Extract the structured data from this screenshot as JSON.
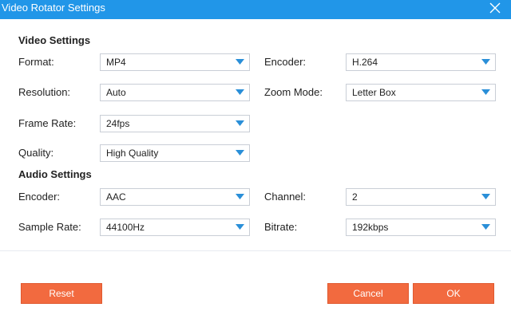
{
  "window": {
    "title": "Video Rotator Settings"
  },
  "video_settings": {
    "heading": "Video Settings",
    "format": {
      "label": "Format:",
      "value": "MP4"
    },
    "encoder": {
      "label": "Encoder:",
      "value": "H.264"
    },
    "resolution": {
      "label": "Resolution:",
      "value": "Auto"
    },
    "zoom_mode": {
      "label": "Zoom Mode:",
      "value": "Letter Box"
    },
    "frame_rate": {
      "label": "Frame Rate:",
      "value": "24fps"
    },
    "quality": {
      "label": "Quality:",
      "value": "High Quality"
    }
  },
  "audio_settings": {
    "heading": "Audio Settings",
    "encoder": {
      "label": "Encoder:",
      "value": "AAC"
    },
    "channel": {
      "label": "Channel:",
      "value": "2"
    },
    "sample_rate": {
      "label": "Sample Rate:",
      "value": "44100Hz"
    },
    "bitrate": {
      "label": "Bitrate:",
      "value": "192kbps"
    }
  },
  "buttons": {
    "reset": "Reset",
    "cancel": "Cancel",
    "ok": "OK"
  },
  "colors": {
    "titlebar": "#2196e8",
    "button": "#f26a3f",
    "dropdown_arrow": "#2a8fd8"
  },
  "icons": {
    "close": "close-icon",
    "dropdown": "chevron-down-icon"
  }
}
